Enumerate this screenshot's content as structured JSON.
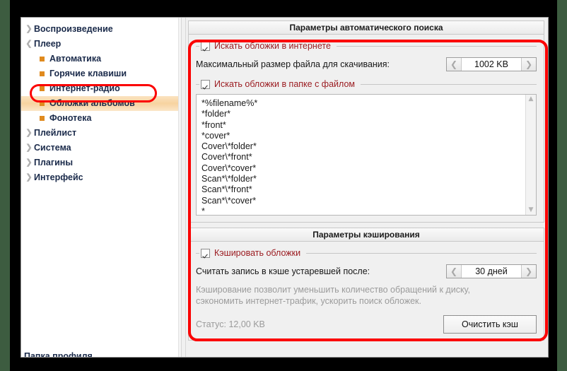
{
  "window": {
    "sidebar_footer": "Папка профиля"
  },
  "sidebar": {
    "items": [
      {
        "label": "Воспроизведение",
        "icon": "chevron-right-icon",
        "level": 0,
        "expanded": false,
        "selected": false
      },
      {
        "label": "Плеер",
        "icon": "chevron-down-icon",
        "level": 0,
        "expanded": true,
        "selected": false
      },
      {
        "label": "Автоматика",
        "icon": "bullet-square-icon",
        "level": 1,
        "selected": false
      },
      {
        "label": "Горячие клавиши",
        "icon": "bullet-square-icon",
        "level": 1,
        "selected": false
      },
      {
        "label": "Интернет-радио",
        "icon": "bullet-square-icon",
        "level": 1,
        "selected": false
      },
      {
        "label": "Обложки альбомов",
        "icon": "bullet-square-icon",
        "level": 1,
        "selected": true
      },
      {
        "label": "Фонотека",
        "icon": "bullet-square-icon",
        "level": 1,
        "selected": false
      },
      {
        "label": "Плейлист",
        "icon": "chevron-right-icon",
        "level": 0,
        "expanded": false,
        "selected": false
      },
      {
        "label": "Система",
        "icon": "chevron-right-icon",
        "level": 0,
        "expanded": false,
        "selected": false
      },
      {
        "label": "Плагины",
        "icon": "chevron-right-icon",
        "level": 0,
        "expanded": false,
        "selected": false
      },
      {
        "label": "Интерфейс",
        "icon": "chevron-right-icon",
        "level": 0,
        "expanded": false,
        "selected": false
      }
    ]
  },
  "autosearch": {
    "header": "Параметры автоматического поиска",
    "internet_group": {
      "checkbox_label": "Искать обложки в интернете",
      "checked": true
    },
    "max_file_size": {
      "label": "Максимальный размер файла для скачивания:",
      "value": "1002 KB",
      "decrement_icon": "chevron-left-icon",
      "increment_icon": "chevron-right-icon"
    },
    "folder_group": {
      "checkbox_label": "Искать обложки в папке с файлом",
      "checked": true
    },
    "patterns": [
      "*%filename%*",
      "*folder*",
      "*front*",
      "*cover*",
      "Cover\\*folder*",
      "Cover\\*front*",
      "Cover\\*cover*",
      "Scan*\\*folder*",
      "Scan*\\*front*",
      "Scan*\\*cover*",
      "*"
    ],
    "scroll_up_icon": "triangle-up-icon",
    "scroll_down_icon": "triangle-down-icon"
  },
  "caching": {
    "header": "Параметры кэширования",
    "cache_group": {
      "checkbox_label": "Кэшировать обложки",
      "checked": true
    },
    "expiry": {
      "label": "Считать запись в кэше устаревшей после:",
      "value": "30 дней",
      "decrement_icon": "chevron-left-icon",
      "increment_icon": "chevron-right-icon"
    },
    "help_text": "Кэширование позволит уменьшить количество обращений к диску, сэкономить интернет-трафик, ускорить поиск обложек.",
    "status": "Статус: 12,00 KB",
    "clear_button": "Очистить кэш"
  },
  "annotations": {
    "highlight_color": "#fb0000",
    "selected_item_accent": "#f7d3a0",
    "group_label_color": "#9b1c21"
  }
}
